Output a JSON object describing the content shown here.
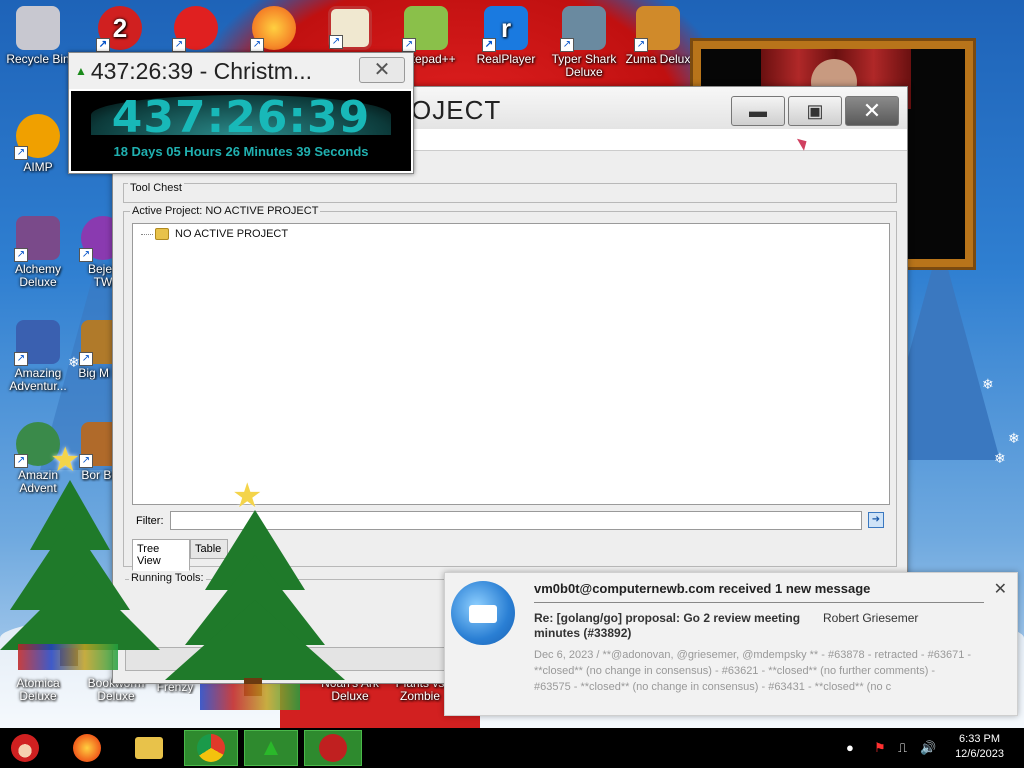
{
  "desktop_icons": [
    {
      "label": "Recycle Bin",
      "color": "#c8c8d0"
    },
    {
      "label": "AIMP",
      "color": "#f0a000"
    },
    {
      "label": "Alchemy Deluxe",
      "color": "#7a4a8a"
    },
    {
      "label": "Amazing Adventur...",
      "color": "#3a60b0"
    },
    {
      "label": "Amazin Advent",
      "color": "#3a8a4a"
    },
    {
      "label": "Atomica Deluxe",
      "color": "#2a7ab0"
    },
    {
      "label": "Bejev TW",
      "color": "#8a3ab0"
    },
    {
      "label": "Big M De",
      "color": "#b07a2a"
    },
    {
      "label": "Bor Boo",
      "color": "#b06a2a"
    },
    {
      "label": "Bookworm Deluxe",
      "color": "#2a8a2a"
    },
    {
      "label": "Treas Frenzy",
      "color": "#c0a020"
    },
    {
      "label": "Noah's Ark Deluxe",
      "color": "#4a7ac0"
    },
    {
      "label": "Plants vs Zombie",
      "color": "#5aa03a"
    },
    {
      "label": "Notepad++",
      "color": "#8ac04a"
    },
    {
      "label": "RealPlayer",
      "color": "#1a7ae0"
    },
    {
      "label": "Typer Shark Deluxe",
      "color": "#6a8aa0"
    },
    {
      "label": "Zuma Delux",
      "color": "#d08a2a"
    }
  ],
  "timer": {
    "title": "437:26:39 - Christm...",
    "big": "437:26:39",
    "small": "18 Days 05 Hours 26 Minutes 39 Seconds"
  },
  "app": {
    "title_fragment": "OJECT",
    "toolchest_label": "Tool Chest",
    "active_project_label": "Active Project: NO ACTIVE PROJECT",
    "tree_root": "NO ACTIVE PROJECT",
    "filter_label": "Filter:",
    "filter_value": "",
    "tabs": [
      "Tree View",
      "Table"
    ],
    "running_tools_label": "Running Tools:"
  },
  "notification": {
    "header": "vm0b0t@computernewb.com received 1 new message",
    "subject": "Re: [golang/go] proposal: Go 2 review meeting minutes (#33892)",
    "from": "Robert Griesemer",
    "preview": "Dec 6, 2023 / **@adonovan, @griesemer, @mdempsky ** - #63878 - retracted - #63671 - **closed** (no change in consensus) - #63621 - **closed** (no further comments) - #63575 - **closed** (no change in consensus) - #63431 - **closed** (no c"
  },
  "taskbar": {
    "buttons": [
      {
        "name": "start-santa",
        "color": "#d02020"
      },
      {
        "name": "firefox",
        "color": "#f07a1a"
      },
      {
        "name": "file-explorer",
        "color": "#e8c24a"
      },
      {
        "name": "chrome",
        "color": "#3a9a3a"
      },
      {
        "name": "christmas-timer",
        "color": "#2a8a2a"
      },
      {
        "name": "typer-shark",
        "color": "#c02020"
      }
    ],
    "clock_time": "6:33 PM",
    "clock_date": "12/6/2023"
  }
}
